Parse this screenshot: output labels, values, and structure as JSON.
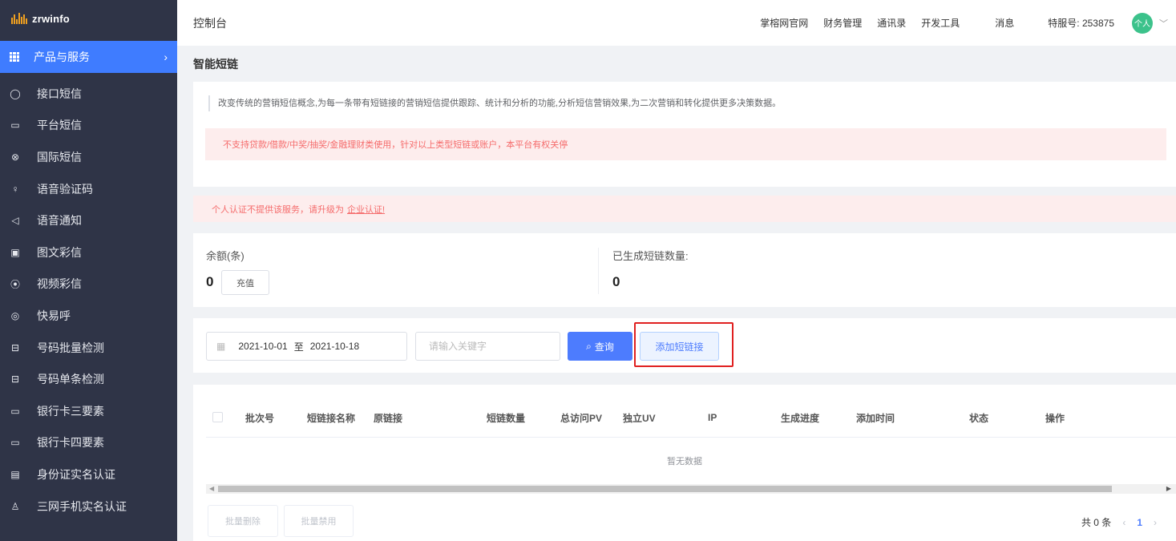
{
  "brand": {
    "name": "zrwinfo"
  },
  "sidebar": {
    "group_label": "产品与服务",
    "items": [
      {
        "label": "接口短信",
        "icon": "chat-bubble-icon"
      },
      {
        "label": "平台短信",
        "icon": "message-icon"
      },
      {
        "label": "国际短信",
        "icon": "globe-icon"
      },
      {
        "label": "语音验证码",
        "icon": "microphone-icon"
      },
      {
        "label": "语音通知",
        "icon": "speaker-icon"
      },
      {
        "label": "图文彩信",
        "icon": "image-icon"
      },
      {
        "label": "视频彩信",
        "icon": "play-icon"
      },
      {
        "label": "快易呼",
        "icon": "phone-circle-icon"
      },
      {
        "label": "号码批量检测",
        "icon": "scan-icon"
      },
      {
        "label": "号码单条检测",
        "icon": "scan-icon"
      },
      {
        "label": "银行卡三要素",
        "icon": "card-icon"
      },
      {
        "label": "银行卡四要素",
        "icon": "card-icon"
      },
      {
        "label": "身份证实名认证",
        "icon": "id-card-icon"
      },
      {
        "label": "三网手机实名认证",
        "icon": "user-icon"
      }
    ]
  },
  "header": {
    "title": "控制台",
    "links": [
      "掌榕网官网",
      "财务管理",
      "通讯录",
      "开发工具"
    ],
    "messages": "消息",
    "service_id": "特服号: 253875",
    "avatar": "个人"
  },
  "page": {
    "title": "智能短链",
    "description": "改变传统的营销短信概念,为每一条带有短链接的营销短信提供跟踪、统计和分析的功能,分析短信营销效果,为二次营销和转化提供更多决策数据。",
    "warning": "不支持贷款/借款/中奖/抽奖/金融理财类使用，针对以上类型短链或账户，本平台有权关停",
    "notice_text": "个人认证不提供该服务，请升级为",
    "notice_link": "企业认证!"
  },
  "balance": {
    "remaining_label": "余额(条)",
    "remaining_value": "0",
    "charge_label": "充值",
    "generated_label": "已生成短链数量:",
    "generated_value": "0"
  },
  "filter": {
    "date_start": "2021-10-01",
    "date_sep": "至",
    "date_end": "2021-10-18",
    "keyword_placeholder": "请输入关键字",
    "query_label": "查询",
    "add_label": "添加短链接"
  },
  "table": {
    "columns": [
      "批次号",
      "短链接名称",
      "原链接",
      "短链数量",
      "总访问PV",
      "独立UV",
      "IP",
      "生成进度",
      "添加时间",
      "状态",
      "操作"
    ],
    "empty_text": "暂无数据",
    "batch_delete": "批量删除",
    "batch_disable": "批量禁用",
    "total": "共 0 条",
    "current_page": "1"
  }
}
